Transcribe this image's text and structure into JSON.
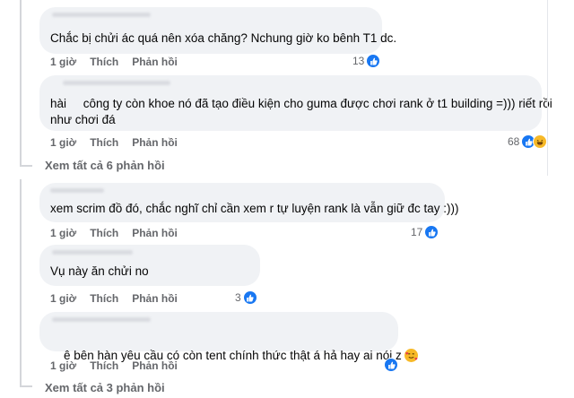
{
  "comments": [
    {
      "text": "Chắc bị chửi ác quá nên xóa chăng? Nchung giờ ko bênh T1 dc.",
      "time": "1 giờ",
      "like": "Thích",
      "reply": "Phản hồi",
      "reactions": "13",
      "reaction_types": [
        "like-icon"
      ]
    },
    {
      "text_line1": "hài     công ty còn khoe nó đã tạo điều kiện cho guma được chơi rank ở t1 building =))) riết rồi",
      "text_line2": "như chơi đá",
      "time": "1 giờ",
      "like": "Thích",
      "reply": "Phản hồi",
      "reactions": "68",
      "reaction_types": [
        "like-icon",
        "haha-icon"
      ]
    },
    {
      "text": "xem scrim đồ đó, chắc nghĩ chỉ cần xem r tự luyện rank là vẫn giữ đc tay :)))",
      "time": "1 giờ",
      "like": "Thích",
      "reply": "Phản hồi",
      "reactions": "17",
      "reaction_types": [
        "like-icon"
      ]
    },
    {
      "text": "Vụ này ăn chửi no",
      "time": "1 giờ",
      "like": "Thích",
      "reply": "Phản hồi",
      "reactions": "3",
      "reaction_types": [
        "like-icon"
      ]
    },
    {
      "text": "ê bên hàn yêu cầu có còn tent chính thức thật á hả hay ai nói z",
      "emoji": "smiling-face-with-hearts-icon",
      "time": "1 giờ",
      "like": "Thích",
      "reply": "Phản hồi",
      "reactions": "",
      "reaction_types": [
        "like-icon"
      ]
    }
  ],
  "view_replies_1": "Xem tất cả 6 phản hồi",
  "view_replies_2": "Xem tất cả 3 phản hồi",
  "colors": {
    "bubble": "#f0f2f5",
    "meta": "#65676b",
    "like": "#1877f2",
    "haha": "#f7b928"
  }
}
